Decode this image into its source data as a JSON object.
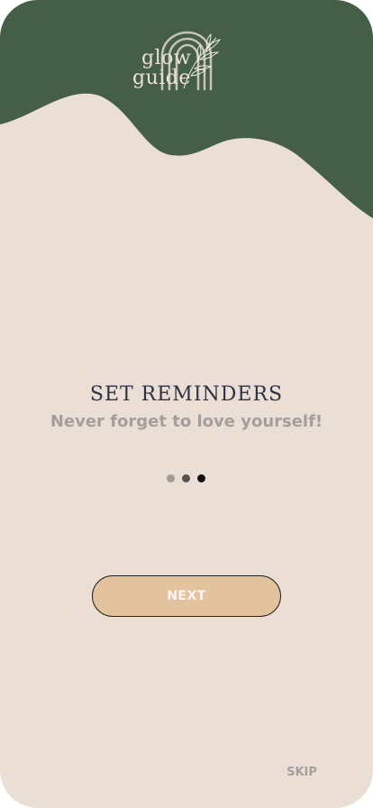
{
  "brand": {
    "logo_line1": "glow",
    "logo_line2": "guide"
  },
  "onboarding": {
    "title": "SET REMINDERS",
    "subtitle": "Never forget to love yourself!",
    "page_count": 3,
    "current_page": 3
  },
  "actions": {
    "next_label": "NEXT",
    "skip_label": "SKIP"
  },
  "colors": {
    "header_green": "#445f45",
    "background": "#ebdfd5",
    "button": "#e3c39e",
    "title": "#2e3348",
    "muted_text": "#a59f9b"
  }
}
